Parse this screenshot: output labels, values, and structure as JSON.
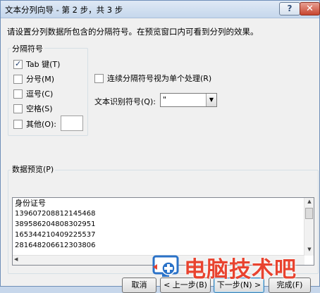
{
  "window": {
    "title": "文本分列向导 - 第 2 步，共 3 步",
    "help_label": "?",
    "close_label": "✕"
  },
  "instructions": "请设置分列数据所包含的分隔符号。在预览窗口内可看到分列的效果。",
  "delimiters": {
    "group_label": "分隔符号",
    "tab": {
      "label": "Tab 键(T)",
      "checked": true
    },
    "semicolon": {
      "label": "分号(M)",
      "checked": false
    },
    "comma": {
      "label": "逗号(C)",
      "checked": false
    },
    "space": {
      "label": "空格(S)",
      "checked": false
    },
    "other": {
      "label": "其他(O):",
      "checked": false,
      "value": ""
    }
  },
  "consecutive": {
    "label": "连续分隔符号视为单个处理(R)",
    "checked": false
  },
  "text_qualifier": {
    "label": "文本识别符号(Q):",
    "value": "\""
  },
  "preview": {
    "group_label": "数据预览(P)",
    "header": "身份证号",
    "rows": [
      "139607208812145468",
      "389586204808302951",
      "165344210409225537",
      "281648206612303806"
    ]
  },
  "buttons": {
    "cancel": "取消",
    "back": "< 上一步(B)",
    "next": "下一步(N) >",
    "finish": "完成(F)"
  },
  "watermark": {
    "text": "电脑技术吧"
  },
  "colors": {
    "accent": "#e8432f",
    "title_bar": "#c5d7ec"
  }
}
